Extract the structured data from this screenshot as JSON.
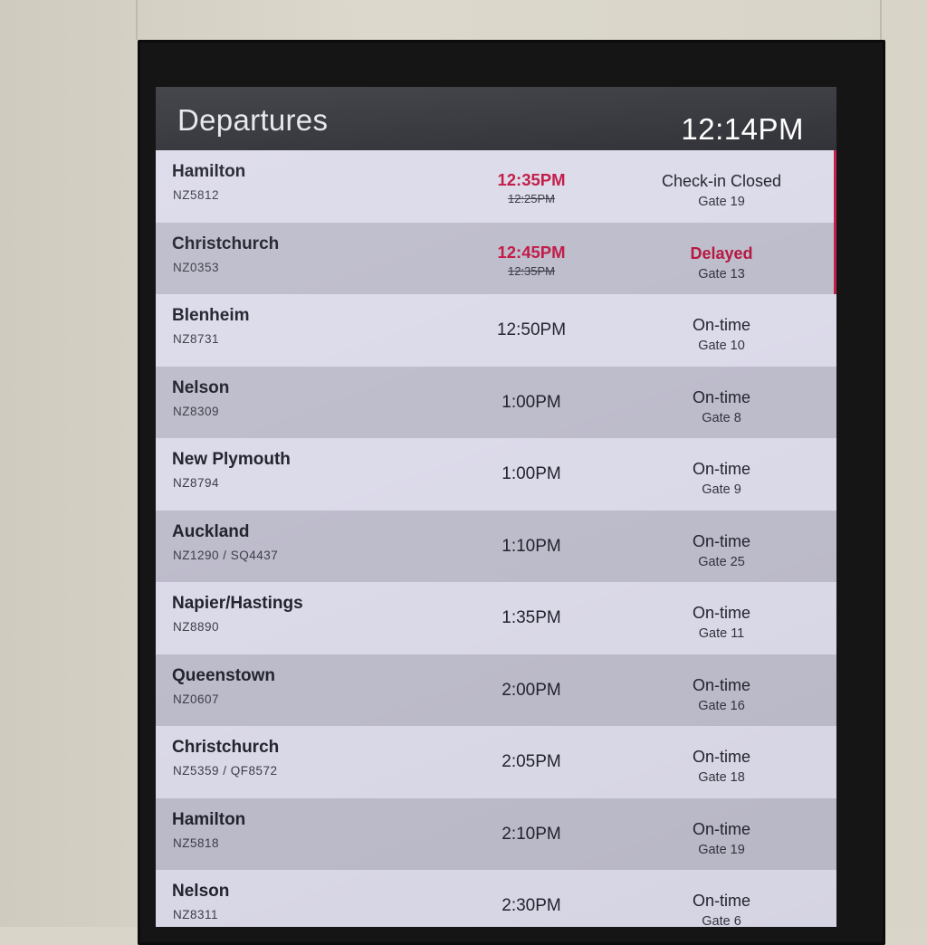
{
  "board": {
    "title": "Departures",
    "clock": "12:14PM"
  },
  "flights": [
    {
      "destination": "Hamilton",
      "flight": "NZ5812",
      "time": "12:35PM",
      "original_time": "12:25PM",
      "status": "Check-in Closed",
      "gate": "Gate 19"
    },
    {
      "destination": "Christchurch",
      "flight": "NZ0353",
      "time": "12:45PM",
      "original_time": "12:35PM",
      "status": "Delayed",
      "gate": "Gate 13"
    },
    {
      "destination": "Blenheim",
      "flight": "NZ8731",
      "time": "12:50PM",
      "status": "On-time",
      "gate": "Gate 10"
    },
    {
      "destination": "Nelson",
      "flight": "NZ8309",
      "time": "1:00PM",
      "status": "On-time",
      "gate": "Gate 8"
    },
    {
      "destination": "New Plymouth",
      "flight": "NZ8794",
      "time": "1:00PM",
      "status": "On-time",
      "gate": "Gate 9"
    },
    {
      "destination": "Auckland",
      "flight": "NZ1290 / SQ4437",
      "time": "1:10PM",
      "status": "On-time",
      "gate": "Gate 25"
    },
    {
      "destination": "Napier/Hastings",
      "flight": "NZ8890",
      "time": "1:35PM",
      "status": "On-time",
      "gate": "Gate 11"
    },
    {
      "destination": "Queenstown",
      "flight": "NZ0607",
      "time": "2:00PM",
      "status": "On-time",
      "gate": "Gate 16"
    },
    {
      "destination": "Christchurch",
      "flight": "NZ5359 / QF8572",
      "time": "2:05PM",
      "status": "On-time",
      "gate": "Gate 18"
    },
    {
      "destination": "Hamilton",
      "flight": "NZ5818",
      "time": "2:10PM",
      "status": "On-time",
      "gate": "Gate 19"
    },
    {
      "destination": "Nelson",
      "flight": "NZ8311",
      "time": "2:30PM",
      "status": "On-time",
      "gate": "Gate 6"
    }
  ],
  "colors": {
    "alert": "#c11845",
    "header_bg": "#33343a",
    "row_light": "#dcdbea",
    "row_dark": "#bebdcc"
  }
}
